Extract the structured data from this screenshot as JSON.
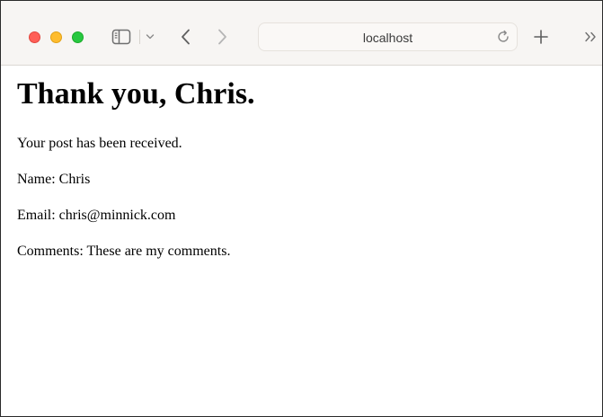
{
  "browser": {
    "address_text": "localhost"
  },
  "page": {
    "heading": "Thank you, Chris.",
    "lines": [
      "Your post has been received.",
      "Name: Chris",
      "Email: chris@minnick.com",
      "Comments: These are my comments."
    ]
  },
  "icons": {
    "close": "close-window-icon",
    "minimize": "minimize-window-icon",
    "zoom": "zoom-window-icon",
    "sidebar": "sidebar-icon",
    "tab_menu": "chevron-down-icon",
    "back": "back-icon",
    "forward": "forward-icon",
    "reload": "reload-icon",
    "new_tab": "plus-icon",
    "overflow": "chevron-double-right-icon"
  },
  "colors": {
    "close": "#ff5f57",
    "minimize": "#febc2e",
    "zoom": "#28c840",
    "toolbar": "#f7f5f3"
  }
}
